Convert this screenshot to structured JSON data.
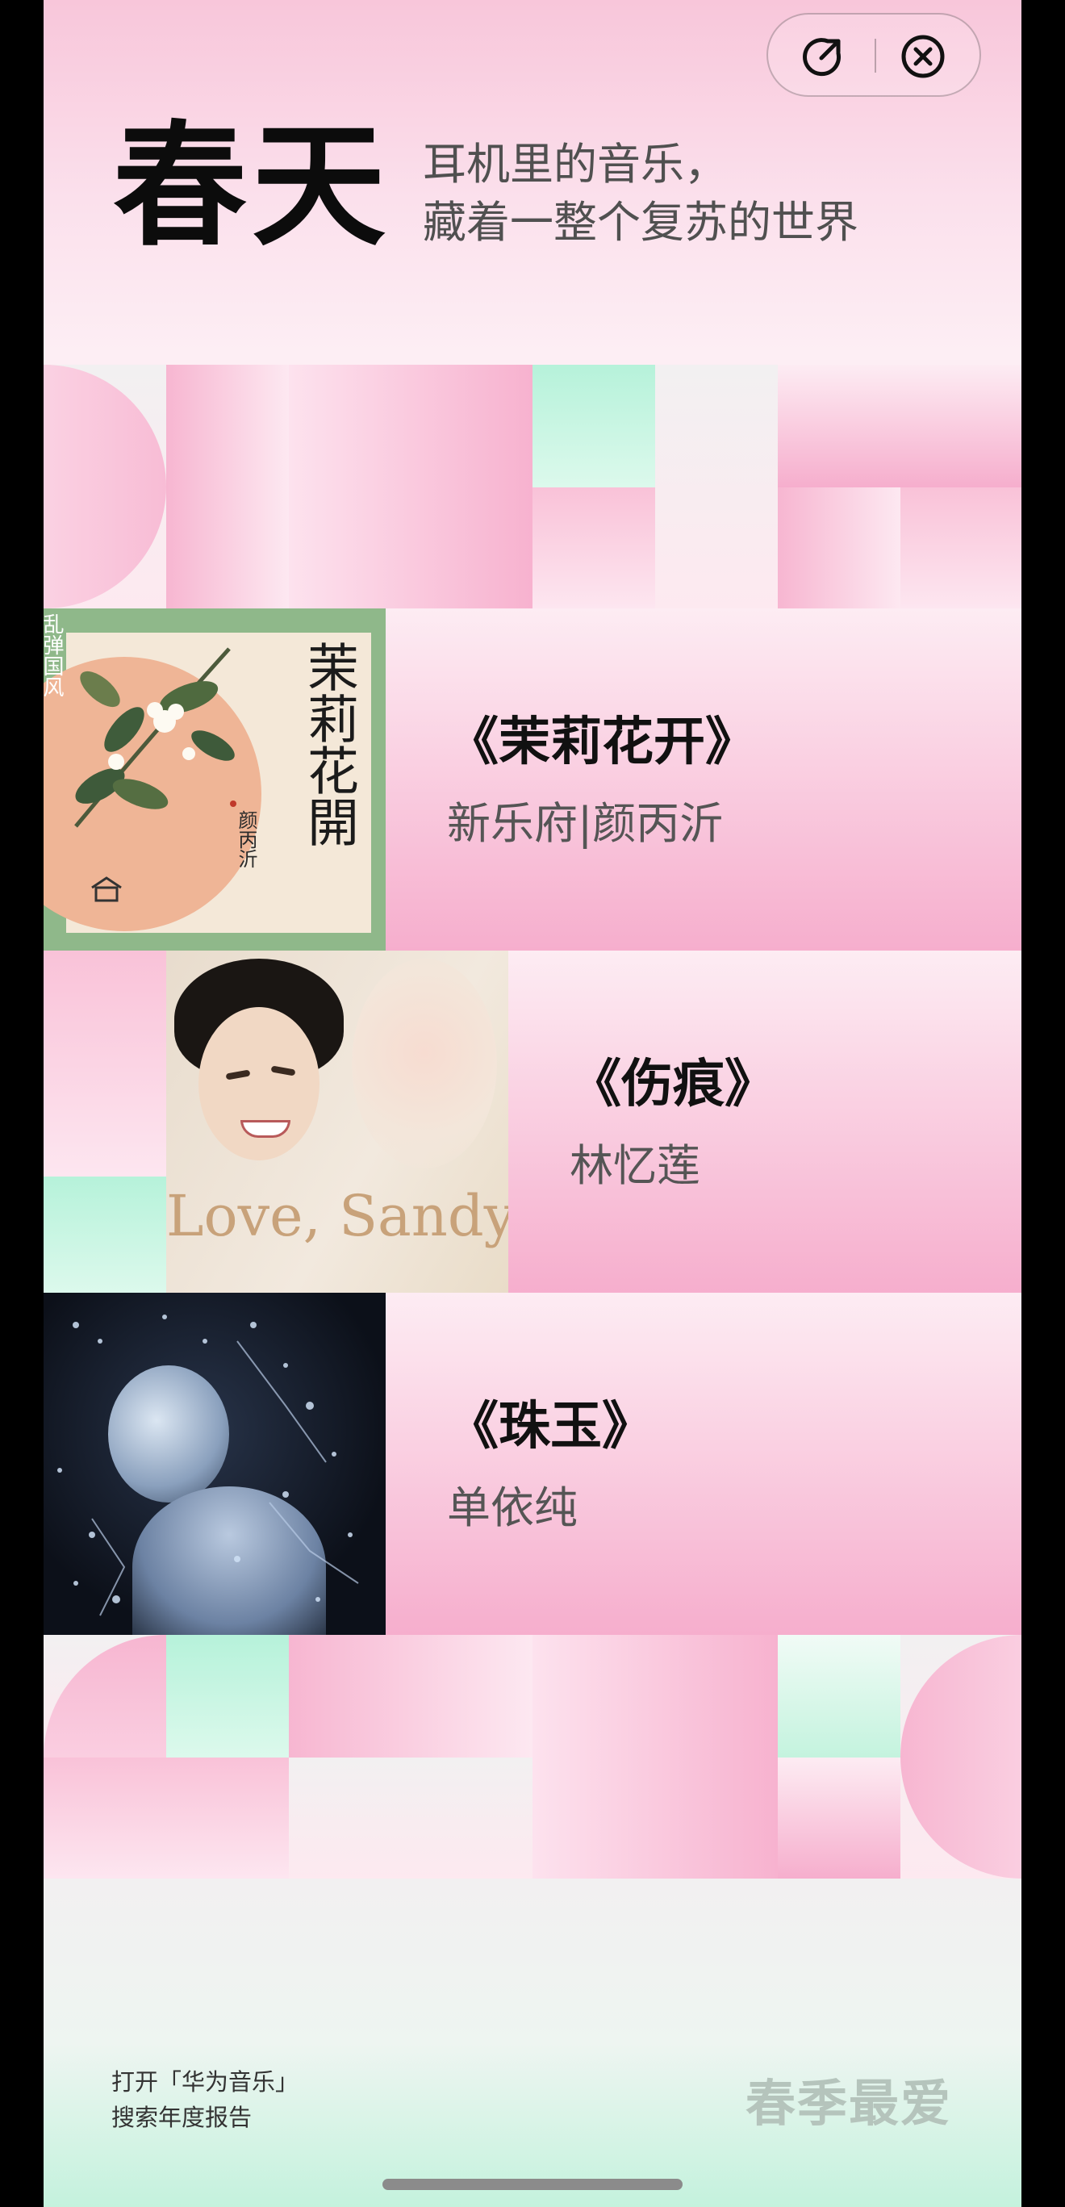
{
  "header": {
    "share_icon": "share-icon",
    "close_icon": "close-icon",
    "headline": "春天",
    "subtitle_line1": "耳机里的音乐，",
    "subtitle_line2": "藏着一整个复苏的世界"
  },
  "songs": [
    {
      "title": "《茉莉花开》",
      "artist": "新乐府|颜丙沂",
      "cover": {
        "side_text": "乱弹国风",
        "calligraphy": "茉莉花開",
        "signature": "颜丙沂"
      }
    },
    {
      "title": "《伤痕》",
      "artist": "林忆莲",
      "cover": {
        "text": "Love, Sandy"
      }
    },
    {
      "title": "《珠玉》",
      "artist": "单依纯",
      "cover": {}
    }
  ],
  "footer": {
    "hint_line1": "打开「华为音乐」",
    "hint_line2": "搜索年度报告",
    "brand": "春季最爱"
  },
  "colors": {
    "pink": "#f7b2cf",
    "light_pink": "#fde6f0",
    "mint": "#b6f2da",
    "cover_green": "#8fb88a"
  }
}
